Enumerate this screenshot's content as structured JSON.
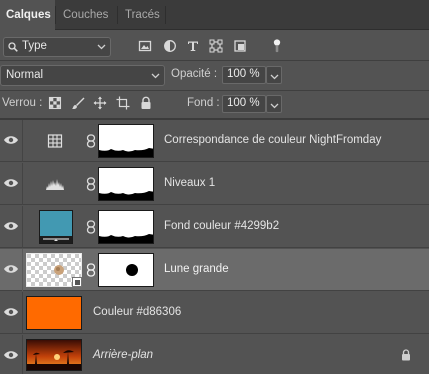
{
  "tabs": [
    {
      "label": "Calques",
      "active": true
    },
    {
      "label": "Couches",
      "active": false
    },
    {
      "label": "Tracés",
      "active": false
    }
  ],
  "filter": {
    "kind_label": "Type",
    "icons": [
      "pixel-filter-icon",
      "adjustment-filter-icon",
      "type-filter-icon",
      "shape-filter-icon",
      "smart-object-filter-icon",
      "filter-toggle-icon"
    ]
  },
  "blend": {
    "mode": "Normal",
    "opacity_label": "Opacité :",
    "opacity_value": "100 %",
    "fill_label": "Fond :",
    "fill_value": "100 %"
  },
  "lock": {
    "label": "Verrou :",
    "icons": [
      "lock-transparent-pixels-icon",
      "lock-image-pixels-icon",
      "lock-position-icon",
      "lock-artboard-icon",
      "lock-all-icon"
    ]
  },
  "layers": [
    {
      "name": "Correspondance de couleur NightFromday",
      "type": "adjustment-color-lookup",
      "visible": true,
      "selected": false,
      "italic": false
    },
    {
      "name": "Niveaux 1",
      "type": "adjustment-levels",
      "visible": true,
      "selected": false,
      "italic": false
    },
    {
      "name": "Fond  couleur #4299b2",
      "type": "fill-layer",
      "fill_color": "#4299b2",
      "visible": true,
      "selected": false,
      "italic": false
    },
    {
      "name": "Lune grande",
      "type": "smart-object",
      "visible": true,
      "selected": true,
      "italic": false
    },
    {
      "name": "Couleur #d86306",
      "type": "color-layer",
      "fill_color": "#d86306",
      "visible": true,
      "selected": false,
      "italic": false
    },
    {
      "name": "Arrière-plan",
      "type": "background",
      "visible": true,
      "selected": false,
      "italic": true,
      "locked": true
    }
  ],
  "colors": {
    "panel_bg": "#535353",
    "tab_bar_bg": "#3b3b3b",
    "selected_row": "#6b6b6b",
    "teal_fill": "#4299b2",
    "orange_fill": "#d86306"
  }
}
